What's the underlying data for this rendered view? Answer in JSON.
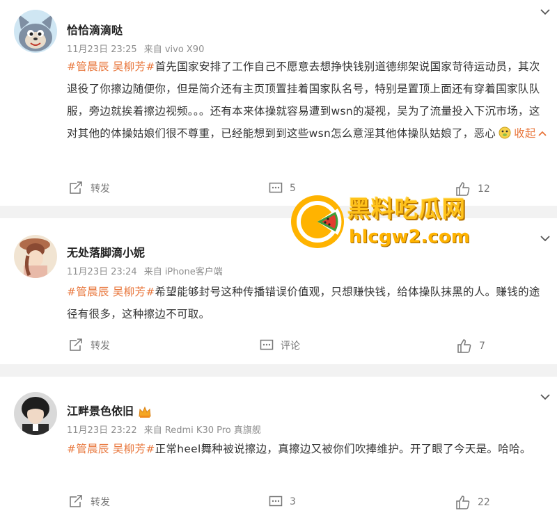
{
  "posts": [
    {
      "username": "恰恰滴滴哒",
      "date": "11月23日 23:25",
      "source": "来自 vivo X90",
      "tags": "#管晨辰 吴柳芳#",
      "text": "首先国家安排了工作自己不愿意去想挣快钱别道德绑架说国家苛待运动员，其次退役了你擦边随便你，但是简介还有主页顶置挂着国家队名号，特别是置顶上面还有穿着国家队队服，旁边就挨着擦边视频。。。还有本来体操就容易遭到wsn的凝视，吴为了流量投入下沉市场，这对其他的体操姑娘们很不尊重，已经能想到到这些wsn怎么意淫其他体操队姑娘了，恶心",
      "collapse_label": "收起",
      "repost_label": "转发",
      "comment_count": "5",
      "like_count": "12"
    },
    {
      "username": "无处落脚滴小妮",
      "date": "11月23日 23:24",
      "source": "来自 iPhone客户端",
      "tags": "#管晨辰 吴柳芳#",
      "text": "希望能够封号这种传播错误价值观，只想赚快钱，给体操队抹黑的人。赚钱的途径有很多，这种擦边不可取。",
      "repost_label": "转发",
      "comment_label": "评论",
      "like_count": "7"
    },
    {
      "username": "江畔景色依旧",
      "date": "11月23日 23:22",
      "source": "来自 Redmi K30 Pro 真旗舰",
      "tags": "#管晨辰 吴柳芳#",
      "text": "正常heel舞种被说擦边，真擦边又被你们吹捧维护。开了眼了今天是。哈哈。",
      "repost_label": "转发",
      "comment_count": "3",
      "like_count": "22"
    }
  ],
  "watermark": {
    "title": "黑料吃瓜网",
    "url": "hlcgw2.com"
  },
  "colors": {
    "tag": "#e8753a",
    "meta": "#8d8d8d",
    "separator": "#f2f2f2"
  }
}
